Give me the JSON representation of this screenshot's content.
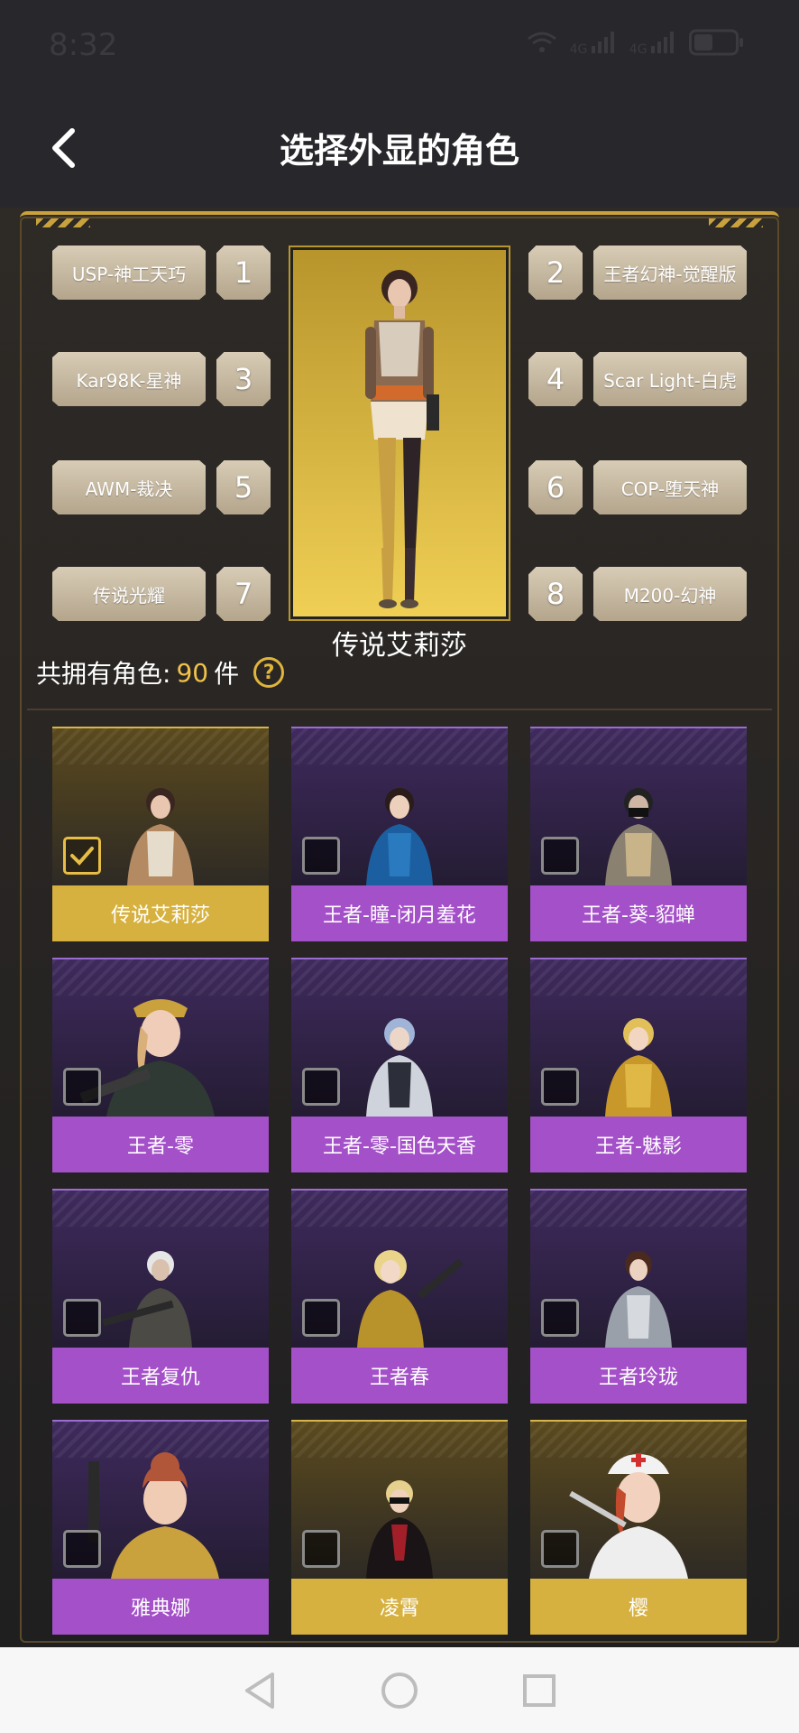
{
  "status_bar": {
    "time": "8:32",
    "signal_1": "4G",
    "signal_2": "4G"
  },
  "header": {
    "title": "选择外显的角色"
  },
  "slots": [
    {
      "number": "1",
      "label": "USP-神工天巧"
    },
    {
      "number": "2",
      "label": "王者幻神-觉醒版"
    },
    {
      "number": "3",
      "label": "Kar98K-星神"
    },
    {
      "number": "4",
      "label": "Scar Light-白虎"
    },
    {
      "number": "5",
      "label": "AWM-裁决"
    },
    {
      "number": "6",
      "label": "COP-堕天神"
    },
    {
      "number": "7",
      "label": "传说光耀"
    },
    {
      "number": "8",
      "label": "M200-幻神"
    }
  ],
  "preview": {
    "name": "传说艾莉莎"
  },
  "summary": {
    "prefix": "共拥有角色:",
    "count": "90",
    "suffix": "件",
    "help_icon": "?"
  },
  "characters": [
    {
      "name": "传说艾莉莎",
      "tier": "gold",
      "selected": true
    },
    {
      "name": "王者-瞳-闭月羞花",
      "tier": "purple",
      "selected": false
    },
    {
      "name": "王者-葵-貂蝉",
      "tier": "purple",
      "selected": false
    },
    {
      "name": "王者-零",
      "tier": "purple",
      "selected": false
    },
    {
      "name": "王者-零-国色天香",
      "tier": "purple",
      "selected": false
    },
    {
      "name": "王者-魅影",
      "tier": "purple",
      "selected": false
    },
    {
      "name": "王者复仇",
      "tier": "purple",
      "selected": false
    },
    {
      "name": "王者春",
      "tier": "purple",
      "selected": false
    },
    {
      "name": "王者玲珑",
      "tier": "purple",
      "selected": false
    },
    {
      "name": "雅典娜",
      "tier": "purple",
      "selected": false
    },
    {
      "name": "凌霄",
      "tier": "gold",
      "selected": false
    },
    {
      "name": "樱",
      "tier": "gold",
      "selected": false
    }
  ],
  "colors": {
    "gold_label": "#d7b13f",
    "purple_label": "#a450c9",
    "accent": "#f0c24a"
  }
}
